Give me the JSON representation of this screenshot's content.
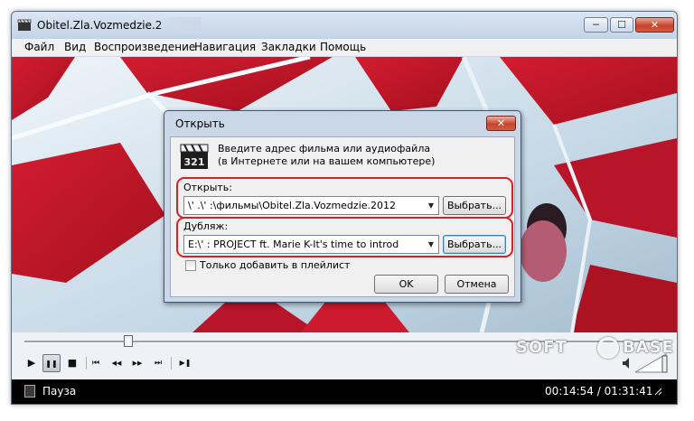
{
  "window": {
    "title": "Obitel.Zla.Vozmedzie.2",
    "controls": {
      "minimize": "─",
      "maximize": "☐",
      "close": "✕"
    }
  },
  "menu": [
    "Файл",
    "Вид",
    "Воспроизведение",
    "Навигация",
    "Закладки",
    "Помощь"
  ],
  "player": {
    "seek_position": 0.163,
    "buttons": {
      "play": "▶",
      "pause": "❚❚",
      "stop": "■",
      "prev": "⏮",
      "rewind": "◀◀",
      "forward": "▶▶",
      "next": "⏭",
      "frame_step": "▶❚"
    },
    "volume_icon": "speaker-icon"
  },
  "status": {
    "text": "Пауза",
    "time": "00:14:54 / 01:31:41"
  },
  "watermark": {
    "left": "SOFT",
    "right": "BASE"
  },
  "dialog": {
    "title": "Открыть",
    "close": "✕",
    "prompt_line1": "Введите адрес фильма или аудиофайла",
    "prompt_line2": "(в Интернете или на вашем компьютере)",
    "open_label": "Открыть:",
    "open_value": "\\'             .\\'         :\\фильмы\\Obitel.Zla.Vozmedzie.2012",
    "open_browse": "Выбрать...",
    "dub_label": "Дубляж:",
    "dub_value": "E:\\'     :           PROJECT ft. Marie K-It's time to introd",
    "dub_browse": "Выбрать...",
    "playlist_only": "Только добавить в плейлист",
    "ok": "OK",
    "cancel": "Отмена"
  },
  "colors": {
    "highlight": "#d8202b",
    "video_red": "#c4182c",
    "video_light": "#dce9f2"
  }
}
